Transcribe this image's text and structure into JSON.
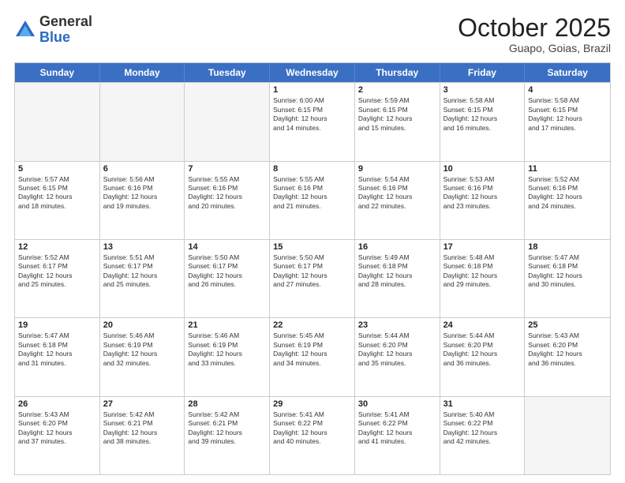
{
  "logo": {
    "general": "General",
    "blue": "Blue"
  },
  "title": "October 2025",
  "location": "Guapo, Goias, Brazil",
  "header_days": [
    "Sunday",
    "Monday",
    "Tuesday",
    "Wednesday",
    "Thursday",
    "Friday",
    "Saturday"
  ],
  "weeks": [
    [
      {
        "day": "",
        "info": ""
      },
      {
        "day": "",
        "info": ""
      },
      {
        "day": "",
        "info": ""
      },
      {
        "day": "1",
        "info": "Sunrise: 6:00 AM\nSunset: 6:15 PM\nDaylight: 12 hours\nand 14 minutes."
      },
      {
        "day": "2",
        "info": "Sunrise: 5:59 AM\nSunset: 6:15 PM\nDaylight: 12 hours\nand 15 minutes."
      },
      {
        "day": "3",
        "info": "Sunrise: 5:58 AM\nSunset: 6:15 PM\nDaylight: 12 hours\nand 16 minutes."
      },
      {
        "day": "4",
        "info": "Sunrise: 5:58 AM\nSunset: 6:15 PM\nDaylight: 12 hours\nand 17 minutes."
      }
    ],
    [
      {
        "day": "5",
        "info": "Sunrise: 5:57 AM\nSunset: 6:15 PM\nDaylight: 12 hours\nand 18 minutes."
      },
      {
        "day": "6",
        "info": "Sunrise: 5:56 AM\nSunset: 6:16 PM\nDaylight: 12 hours\nand 19 minutes."
      },
      {
        "day": "7",
        "info": "Sunrise: 5:55 AM\nSunset: 6:16 PM\nDaylight: 12 hours\nand 20 minutes."
      },
      {
        "day": "8",
        "info": "Sunrise: 5:55 AM\nSunset: 6:16 PM\nDaylight: 12 hours\nand 21 minutes."
      },
      {
        "day": "9",
        "info": "Sunrise: 5:54 AM\nSunset: 6:16 PM\nDaylight: 12 hours\nand 22 minutes."
      },
      {
        "day": "10",
        "info": "Sunrise: 5:53 AM\nSunset: 6:16 PM\nDaylight: 12 hours\nand 23 minutes."
      },
      {
        "day": "11",
        "info": "Sunrise: 5:52 AM\nSunset: 6:16 PM\nDaylight: 12 hours\nand 24 minutes."
      }
    ],
    [
      {
        "day": "12",
        "info": "Sunrise: 5:52 AM\nSunset: 6:17 PM\nDaylight: 12 hours\nand 25 minutes."
      },
      {
        "day": "13",
        "info": "Sunrise: 5:51 AM\nSunset: 6:17 PM\nDaylight: 12 hours\nand 25 minutes."
      },
      {
        "day": "14",
        "info": "Sunrise: 5:50 AM\nSunset: 6:17 PM\nDaylight: 12 hours\nand 26 minutes."
      },
      {
        "day": "15",
        "info": "Sunrise: 5:50 AM\nSunset: 6:17 PM\nDaylight: 12 hours\nand 27 minutes."
      },
      {
        "day": "16",
        "info": "Sunrise: 5:49 AM\nSunset: 6:18 PM\nDaylight: 12 hours\nand 28 minutes."
      },
      {
        "day": "17",
        "info": "Sunrise: 5:48 AM\nSunset: 6:18 PM\nDaylight: 12 hours\nand 29 minutes."
      },
      {
        "day": "18",
        "info": "Sunrise: 5:47 AM\nSunset: 6:18 PM\nDaylight: 12 hours\nand 30 minutes."
      }
    ],
    [
      {
        "day": "19",
        "info": "Sunrise: 5:47 AM\nSunset: 6:18 PM\nDaylight: 12 hours\nand 31 minutes."
      },
      {
        "day": "20",
        "info": "Sunrise: 5:46 AM\nSunset: 6:19 PM\nDaylight: 12 hours\nand 32 minutes."
      },
      {
        "day": "21",
        "info": "Sunrise: 5:46 AM\nSunset: 6:19 PM\nDaylight: 12 hours\nand 33 minutes."
      },
      {
        "day": "22",
        "info": "Sunrise: 5:45 AM\nSunset: 6:19 PM\nDaylight: 12 hours\nand 34 minutes."
      },
      {
        "day": "23",
        "info": "Sunrise: 5:44 AM\nSunset: 6:20 PM\nDaylight: 12 hours\nand 35 minutes."
      },
      {
        "day": "24",
        "info": "Sunrise: 5:44 AM\nSunset: 6:20 PM\nDaylight: 12 hours\nand 36 minutes."
      },
      {
        "day": "25",
        "info": "Sunrise: 5:43 AM\nSunset: 6:20 PM\nDaylight: 12 hours\nand 36 minutes."
      }
    ],
    [
      {
        "day": "26",
        "info": "Sunrise: 5:43 AM\nSunset: 6:20 PM\nDaylight: 12 hours\nand 37 minutes."
      },
      {
        "day": "27",
        "info": "Sunrise: 5:42 AM\nSunset: 6:21 PM\nDaylight: 12 hours\nand 38 minutes."
      },
      {
        "day": "28",
        "info": "Sunrise: 5:42 AM\nSunset: 6:21 PM\nDaylight: 12 hours\nand 39 minutes."
      },
      {
        "day": "29",
        "info": "Sunrise: 5:41 AM\nSunset: 6:22 PM\nDaylight: 12 hours\nand 40 minutes."
      },
      {
        "day": "30",
        "info": "Sunrise: 5:41 AM\nSunset: 6:22 PM\nDaylight: 12 hours\nand 41 minutes."
      },
      {
        "day": "31",
        "info": "Sunrise: 5:40 AM\nSunset: 6:22 PM\nDaylight: 12 hours\nand 42 minutes."
      },
      {
        "day": "",
        "info": ""
      }
    ]
  ]
}
